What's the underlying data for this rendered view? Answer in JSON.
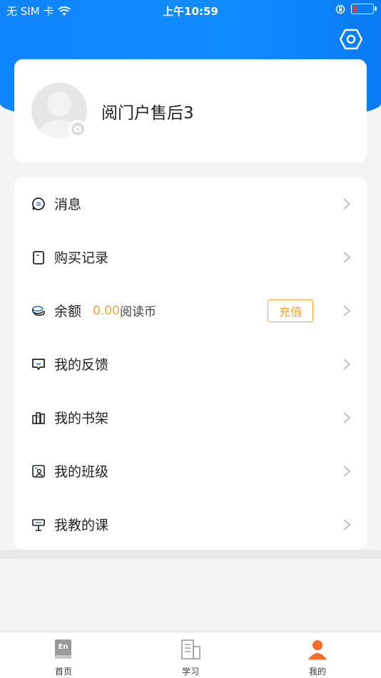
{
  "status_bar": {
    "carrier": "无 SIM 卡",
    "time": "上午10:59"
  },
  "profile": {
    "username": "阅门户售后3"
  },
  "menu": {
    "messages": "消息",
    "purchases": "购买记录",
    "balance_label": "余额",
    "balance_value": "0.00",
    "balance_unit": "阅读币",
    "recharge": "充值",
    "feedback": "我的反馈",
    "bookshelf": "我的书架",
    "classes": "我的班级",
    "courses": "我教的课"
  },
  "tabs": [
    {
      "label": "首页",
      "icon": "book-en-icon"
    },
    {
      "label": "学习",
      "icon": "building-icon"
    },
    {
      "label": "我的",
      "icon": "person-icon",
      "active": true
    }
  ],
  "colors": {
    "primary": "#0f84ff",
    "accent": "#f5a433",
    "active_tab": "#f36c2b"
  }
}
